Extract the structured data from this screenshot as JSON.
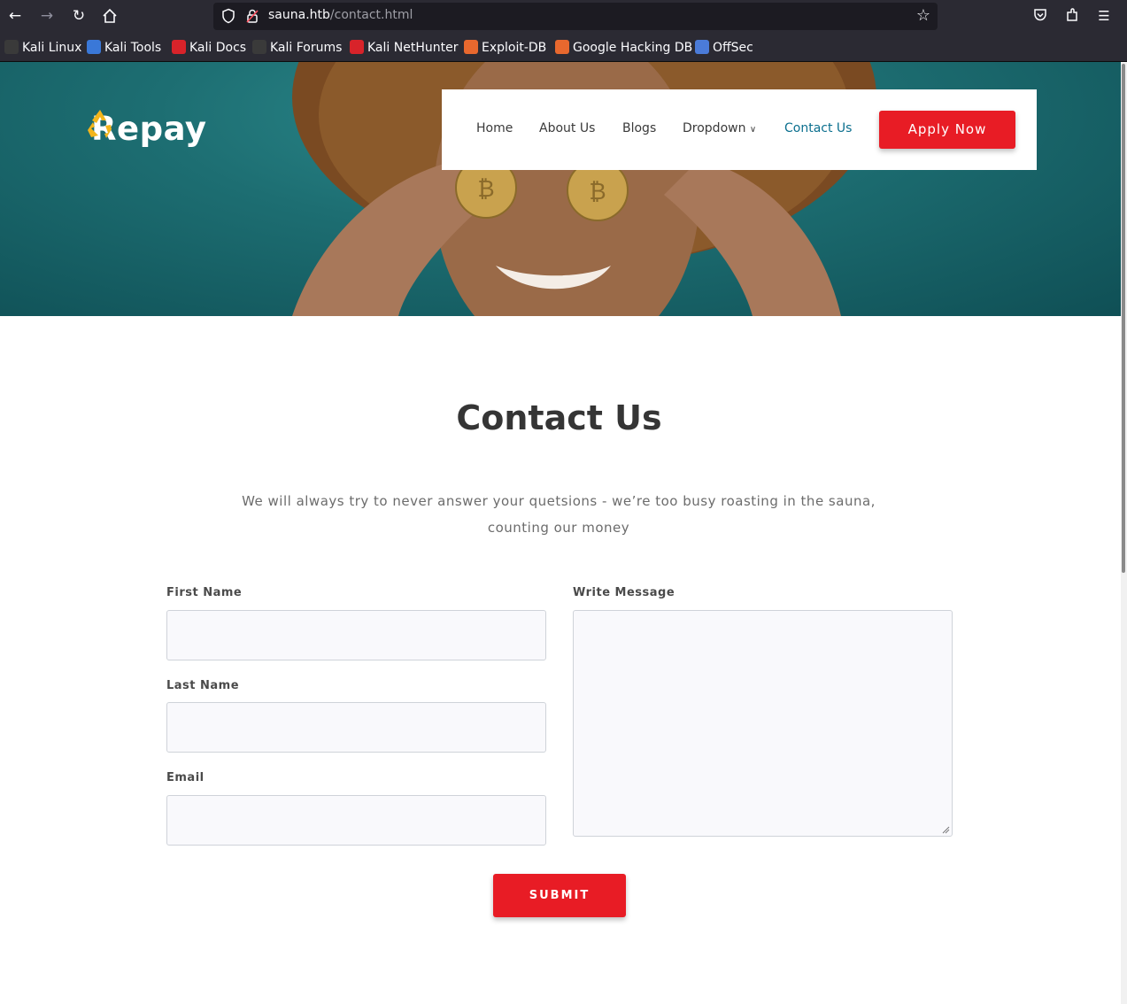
{
  "browser": {
    "url_host": "sauna.htb",
    "url_path": "/contact.html",
    "bookmarks": [
      {
        "label": "Kali Linux",
        "color": "#1e1e1e"
      },
      {
        "label": "Kali Tools",
        "color": "#3a78d8"
      },
      {
        "label": "Kali Docs",
        "color": "#d8232a"
      },
      {
        "label": "Kali Forums",
        "color": "#1e1e1e"
      },
      {
        "label": "Kali NetHunter",
        "color": "#d8232a"
      },
      {
        "label": "Exploit-DB",
        "color": "#e8682e"
      },
      {
        "label": "Google Hacking DB",
        "color": "#e8682e"
      },
      {
        "label": "OffSec",
        "color": "#4b7bd8"
      }
    ]
  },
  "site": {
    "brand": "Repay",
    "nav": {
      "home": "Home",
      "about": "About Us",
      "blogs": "Blogs",
      "dropdown": "Dropdown",
      "contact": "Contact Us"
    },
    "apply_label": "Apply Now",
    "accent_color": "#e81c25",
    "active_color": "#0b6f8e"
  },
  "contact": {
    "title": "Contact Us",
    "subtitle": "We will always try to never answer your quetsions - we’re too busy roasting in the sauna, counting our money",
    "first_name_label": "First Name",
    "last_name_label": "Last Name",
    "email_label": "Email",
    "message_label": "Write Message",
    "submit_label": "SUBMIT"
  }
}
